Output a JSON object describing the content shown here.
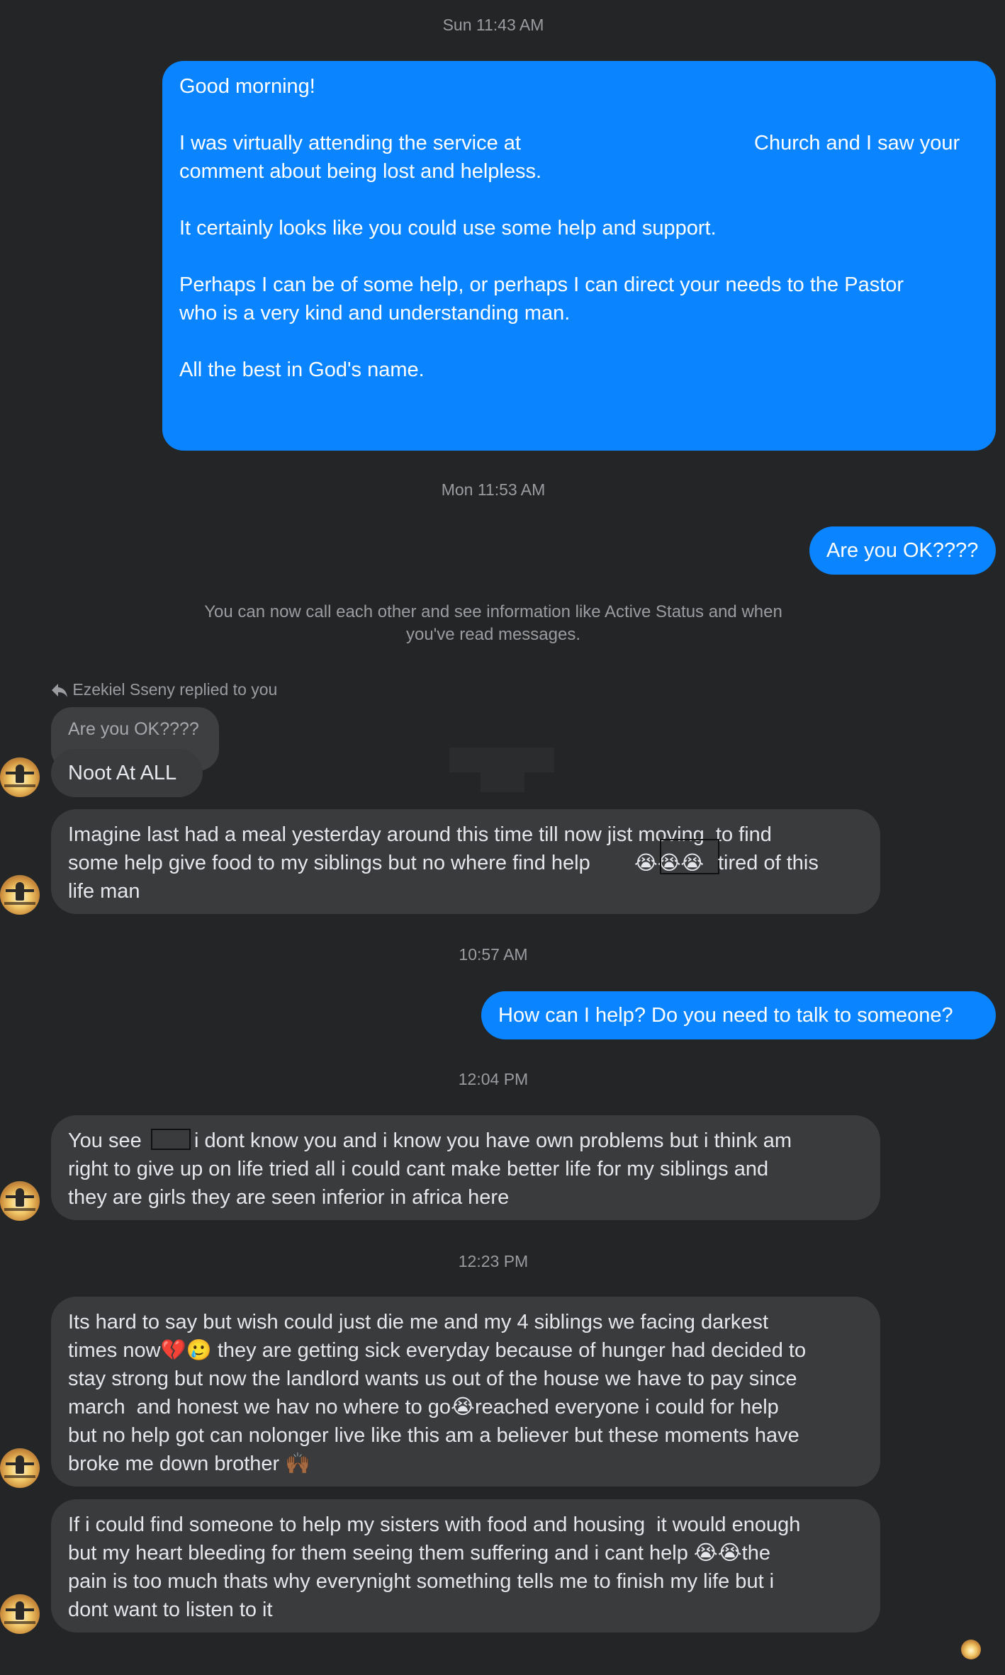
{
  "timestamps": {
    "t1": "Sun 11:43 AM",
    "t2": "Mon 11:53 AM",
    "t3": "10:57 AM",
    "t4": "12:04 PM",
    "t5": "12:23 PM"
  },
  "messages": {
    "m1": {
      "line1": "Good morning!",
      "line2a": "I was virtually attending the service at",
      "line2b": "Church and I saw your",
      "line3": "comment about being lost and helpless.",
      "line4": "It certainly looks like you could use some help and support.",
      "line5": "Perhaps I can be of some help, or perhaps I can direct your needs to the Pastor",
      "line6": "who is a very kind and understanding man.",
      "line7": "All the best in God's name."
    },
    "m2": "Are you OK????",
    "m3": "How can I help? Do you need to talk to someone?"
  },
  "system_notice": {
    "line1": "You can now call each other and see information like Active Status and when",
    "line2": "you've read messages."
  },
  "reply": {
    "header": "Ezekiel Sseny replied to you",
    "quoted": "Are you OK????",
    "text": "Noot At ALL"
  },
  "incoming": {
    "i1": {
      "line1": "Imagine last had a meal yesterday around this time till now jist moving  to find",
      "line2a": "some help give food to my siblings but no where find help ",
      "emojis": "😭😭😭",
      "line2b": "tired of this",
      "line3": "life man"
    },
    "i2": {
      "line1a": "You see",
      "line1b": "i dont know you and i know you have own problems but i think am",
      "line2": "right to give up on life tried all i could cant make better life for my siblings and",
      "line3": "they are girls they are seen inferior in africa here"
    },
    "i3": {
      "line1": "Its hard to say but wish could just die me and my 4 siblings we facing darkest",
      "line2": "times now💔🥲 they are getting sick everyday because of hunger had decided to",
      "line3": "stay strong but now the landlord wants us out of the house we have to pay since",
      "line4": "march  and honest we hav no where to go😭reached everyone i could for help",
      "line5": "but no help got can nolonger live like this am a believer but these moments have",
      "line6": "broke me down brother 🙌🏾"
    },
    "i4": {
      "line1": "If i could find someone to help my sisters with food and housing  it would enough",
      "line2": "but my heart bleeding for them seeing them suffering and i cant help 😭😭the",
      "line3": "pain is too much thats why everynight something tells me to finish my life but i",
      "line4": "dont want to listen to it"
    }
  },
  "colors": {
    "background": "#242526",
    "outgoing": "#0a84ff",
    "incoming": "#3a3b3c",
    "timestamp": "#9a9ca0"
  },
  "icons": {
    "reply": "reply-arrow-icon"
  }
}
